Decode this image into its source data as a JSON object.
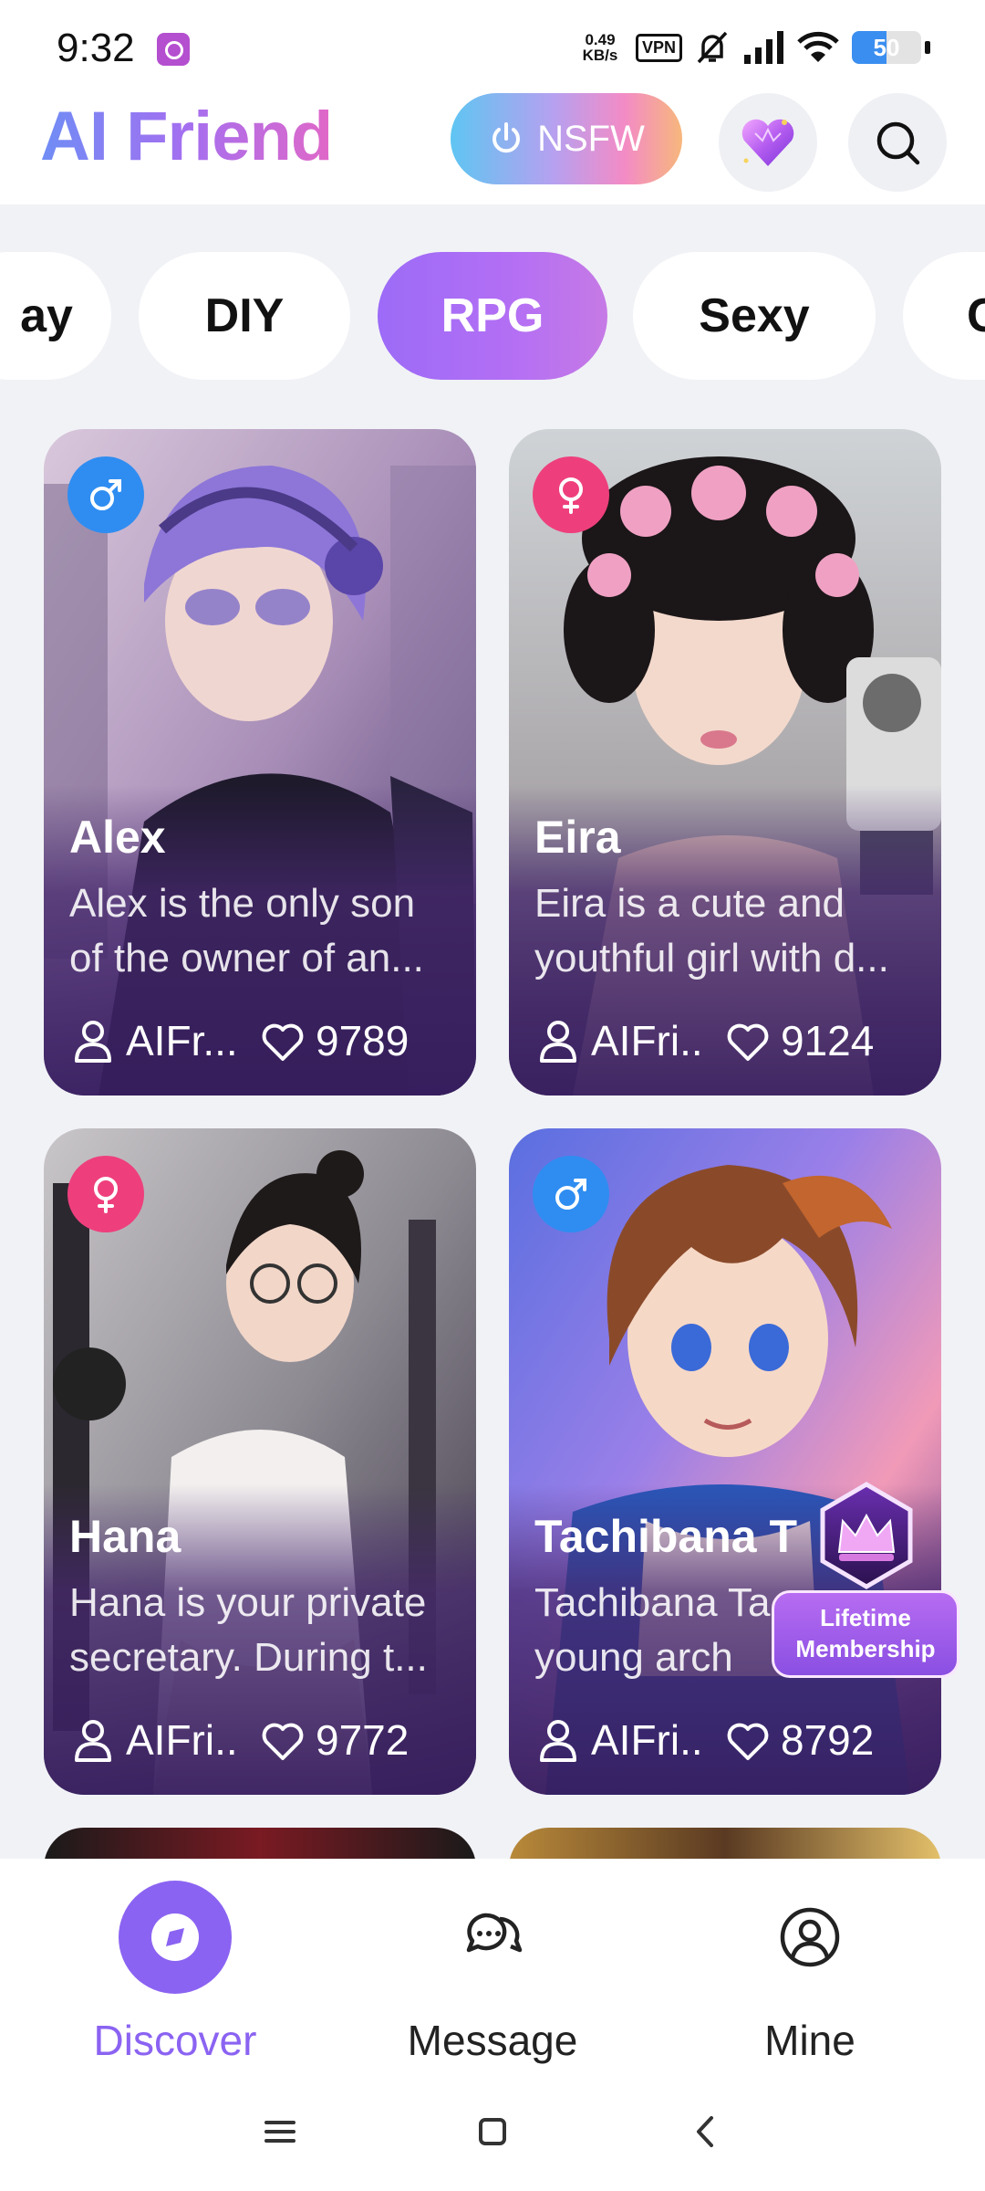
{
  "status_bar": {
    "time": "9:32",
    "net_speed": "0.49\nKB/s",
    "vpn": "VPN",
    "battery": "50",
    "battery_level": 0.5
  },
  "header": {
    "title": "AI Friend",
    "nsfw_label": "NSFW",
    "icons": [
      "power-icon",
      "heart-gem-icon",
      "search-icon"
    ]
  },
  "categories": [
    {
      "label": "ay",
      "active": false
    },
    {
      "label": "DIY",
      "active": false
    },
    {
      "label": "RPG",
      "active": true
    },
    {
      "label": "Sexy",
      "active": false
    },
    {
      "label": "C",
      "active": false
    }
  ],
  "cards": [
    {
      "name": "Alex",
      "gender": "male",
      "desc": "Alex is the only son of the owner of an...",
      "author": "AIFr...",
      "likes": "9789"
    },
    {
      "name": "Eira",
      "gender": "female",
      "desc": "Eira is a cute and youthful girl with d...",
      "author": "AIFri...",
      "likes": "9124"
    },
    {
      "name": "Hana",
      "gender": "female",
      "desc": "Hana is your private secretary. During t...",
      "author": "AIFri...",
      "likes": "9772"
    },
    {
      "name": "Tachibana T",
      "gender": "male",
      "desc": "Tachibana Ta a young arch",
      "author": "AIFri...",
      "likes": "8792"
    }
  ],
  "membership_badge": {
    "line1": "Lifetime",
    "line2": "Membership"
  },
  "bottom_nav": [
    {
      "label": "Discover",
      "icon": "compass-icon",
      "active": true
    },
    {
      "label": "Message",
      "icon": "chat-bubbles-icon",
      "active": false
    },
    {
      "label": "Mine",
      "icon": "user-circle-icon",
      "active": false
    }
  ],
  "colors": {
    "accent": "#8b63f2",
    "male_badge": "#2f8df1",
    "female_badge": "#ee3f7c"
  }
}
